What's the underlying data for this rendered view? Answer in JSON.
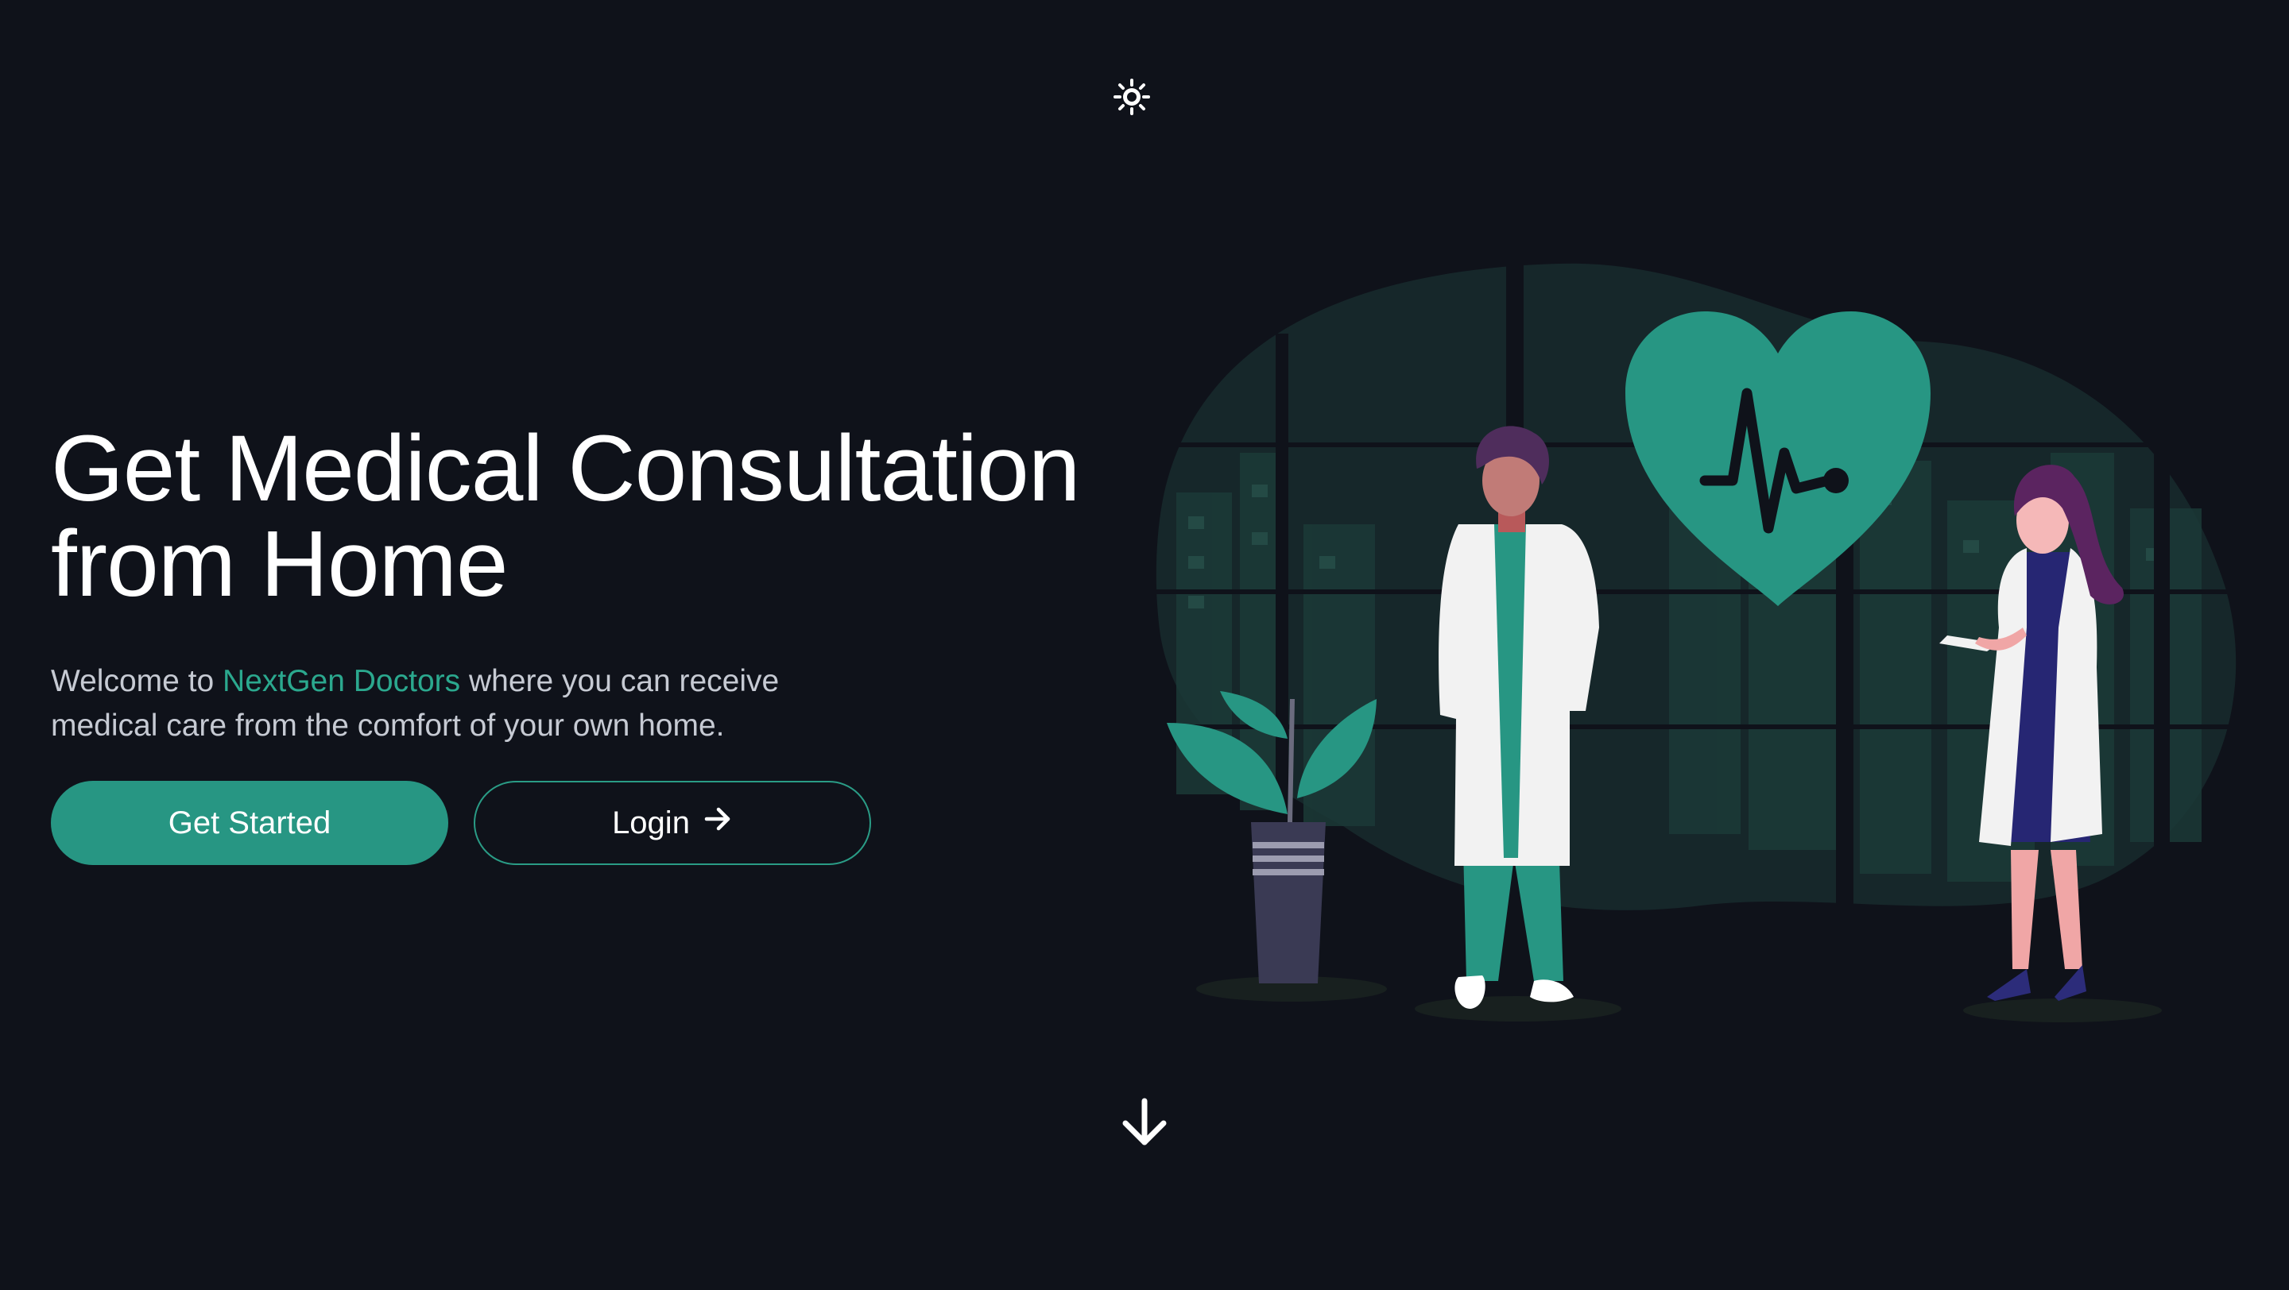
{
  "header": {
    "theme_toggle_icon": "sun-icon"
  },
  "hero": {
    "title_line1": "Get Medical Consultation",
    "title_line2": "from Home",
    "subtitle_prefix": "Welcome to ",
    "brand_name": "NextGen Doctors",
    "subtitle_suffix": " where you can receive medical care from the comfort of your own home.",
    "primary_button": "Get Started",
    "secondary_button": "Login",
    "secondary_button_icon": "arrow-right-icon"
  },
  "footer": {
    "scroll_icon": "arrow-down-icon"
  },
  "colors": {
    "background": "#0f121a",
    "accent": "#279683",
    "brand_text": "#2ba88e"
  }
}
